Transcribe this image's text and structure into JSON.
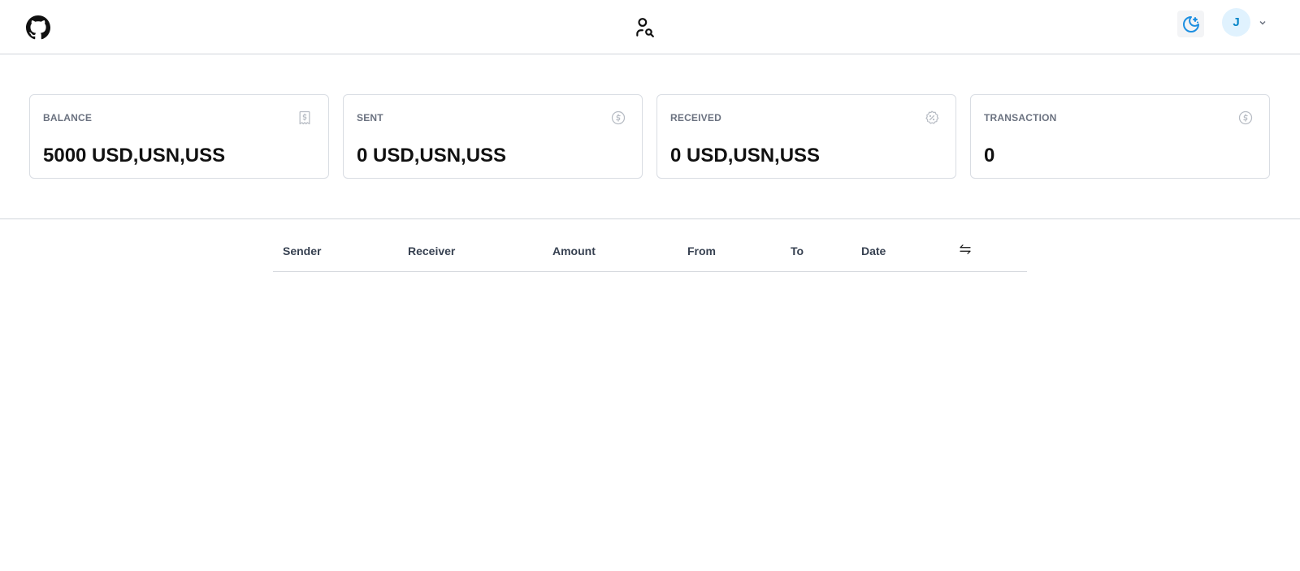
{
  "header": {
    "logo_icon": "github-icon",
    "search_icon": "user-search-icon",
    "theme_icon": "moon-stars-icon",
    "avatar_initial": "J",
    "dropdown_icon": "chevron-down-icon"
  },
  "stats": [
    {
      "label": "BALANCE",
      "value": "5000 USD,USN,USS",
      "icon": "receipt-dollar-icon"
    },
    {
      "label": "SENT",
      "value": "0 USD,USN,USS",
      "icon": "circle-dollar-icon"
    },
    {
      "label": "RECEIVED",
      "value": "0 USD,USN,USS",
      "icon": "discount-badge-icon"
    },
    {
      "label": "TRANSACTION",
      "value": "0",
      "icon": "circle-dollar-icon"
    }
  ],
  "table": {
    "columns": [
      "Sender",
      "Receiver",
      "Amount",
      "From",
      "To",
      "Date"
    ],
    "rows": [],
    "sort_icon": "arrows-exchange-icon"
  },
  "colors": {
    "accent": "#0284c7",
    "avatar_bg": "#e0f2fe",
    "border": "#d1d5db"
  }
}
